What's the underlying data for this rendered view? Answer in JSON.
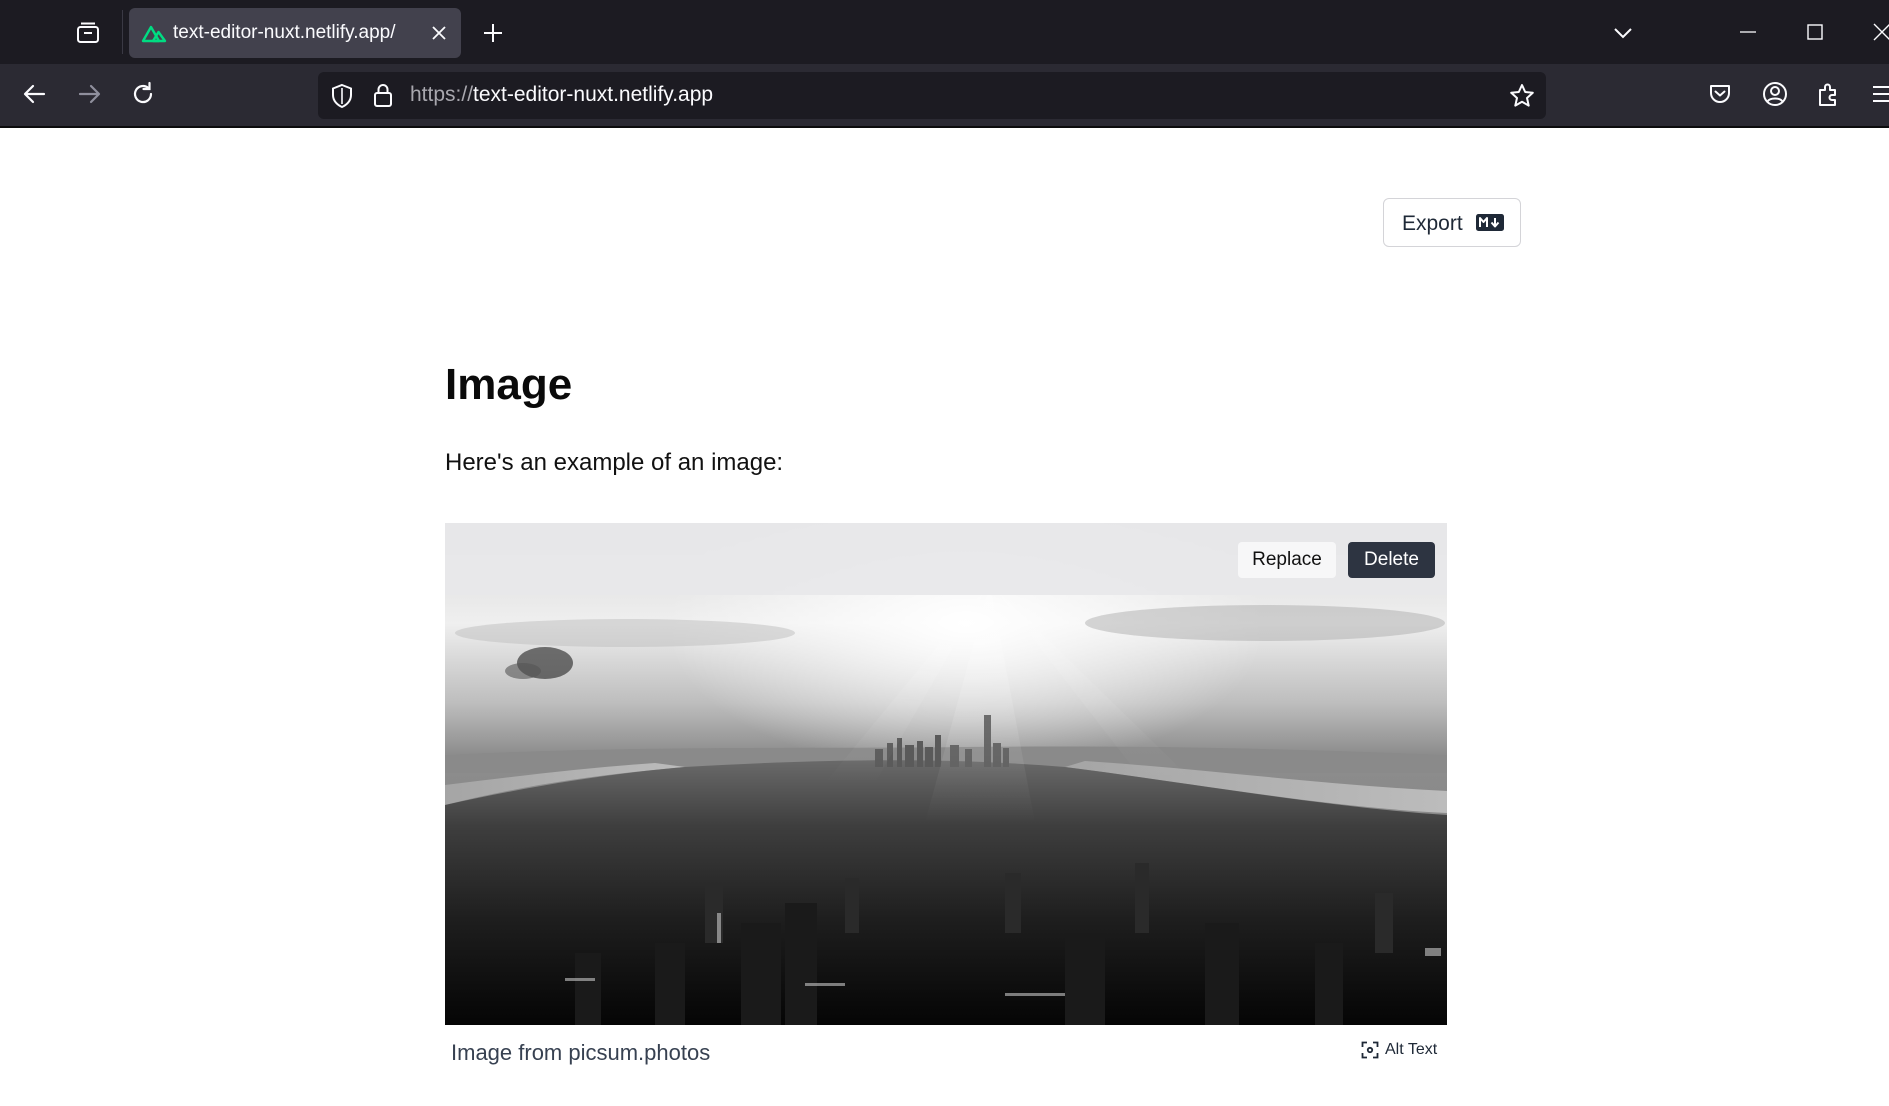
{
  "browser": {
    "tab": {
      "title": "text-editor-nuxt.netlify.app/",
      "favicon": "nuxt-logo-icon"
    },
    "address_bar": {
      "scheme": "https://",
      "host": "text-editor-nuxt.netlify.app"
    },
    "icons": [
      "tab-list-icon",
      "close-icon",
      "new-tab-icon",
      "tabs-menu-chevron-icon",
      "minimize-icon",
      "maximize-icon",
      "window-close-icon",
      "back-icon",
      "forward-icon",
      "reload-icon",
      "shield-icon",
      "lock-icon",
      "bookmark-star-icon",
      "pocket-icon",
      "account-icon",
      "extensions-icon",
      "app-menu-icon"
    ],
    "colors": {
      "tab_bar": "#1c1b22",
      "nav_bar": "#2b2a33",
      "active_tab": "#42414d",
      "nuxt_green": "#00dc82"
    }
  },
  "toolbar": {
    "export_label": "Export",
    "export_icon": "markdown-icon"
  },
  "content": {
    "heading": "Image",
    "paragraph": "Here's an example of an image:",
    "image": {
      "subject": "grayscale aerial city skyline",
      "replace_label": "Replace",
      "delete_label": "Delete",
      "caption": "Image from picsum.photos",
      "alt_text_label": "Alt Text",
      "alt_text_icon": "alt-text-scan-icon"
    },
    "colors": {
      "delete_button": "#2d3441",
      "toolbar_overlay": "#e8e8ea"
    }
  }
}
